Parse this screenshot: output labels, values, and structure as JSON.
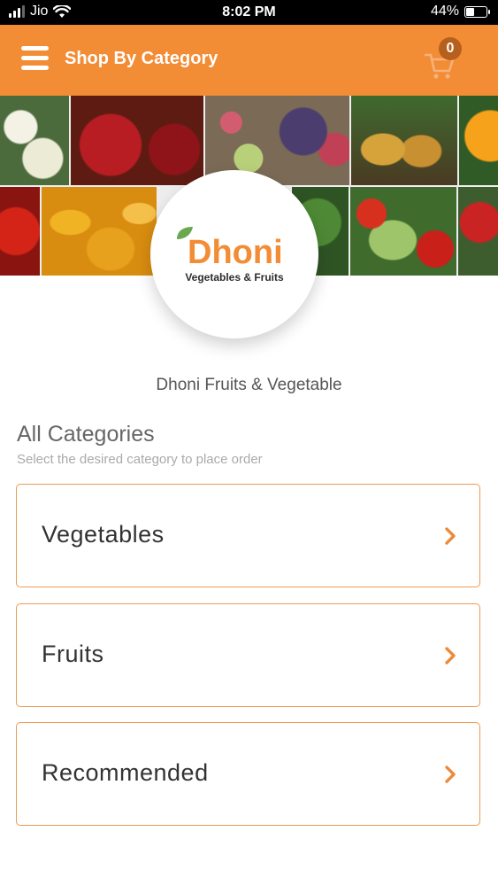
{
  "status_bar": {
    "carrier": "Jio",
    "time": "8:02 PM",
    "battery": "44%",
    "battery_level": 0.44
  },
  "header": {
    "title": "Shop By Category",
    "menu_icon": "hamburger-menu-icon",
    "cart_icon": "shopping-cart-icon",
    "cart_count": "0"
  },
  "logo": {
    "brand": "Dhoni",
    "tagline": "Vegetables & Fruits"
  },
  "shop_name": "Dhoni Fruits & Vegetable",
  "categories_section": {
    "title": "All Categories",
    "subtitle": "Select the desired category to place order",
    "items": [
      {
        "label": "Vegetables"
      },
      {
        "label": "Fruits"
      },
      {
        "label": "Recommended"
      }
    ],
    "chevron_icon": "chevron-right-icon"
  },
  "colors": {
    "accent": "#f28c35",
    "card_border": "#ec9a55"
  }
}
